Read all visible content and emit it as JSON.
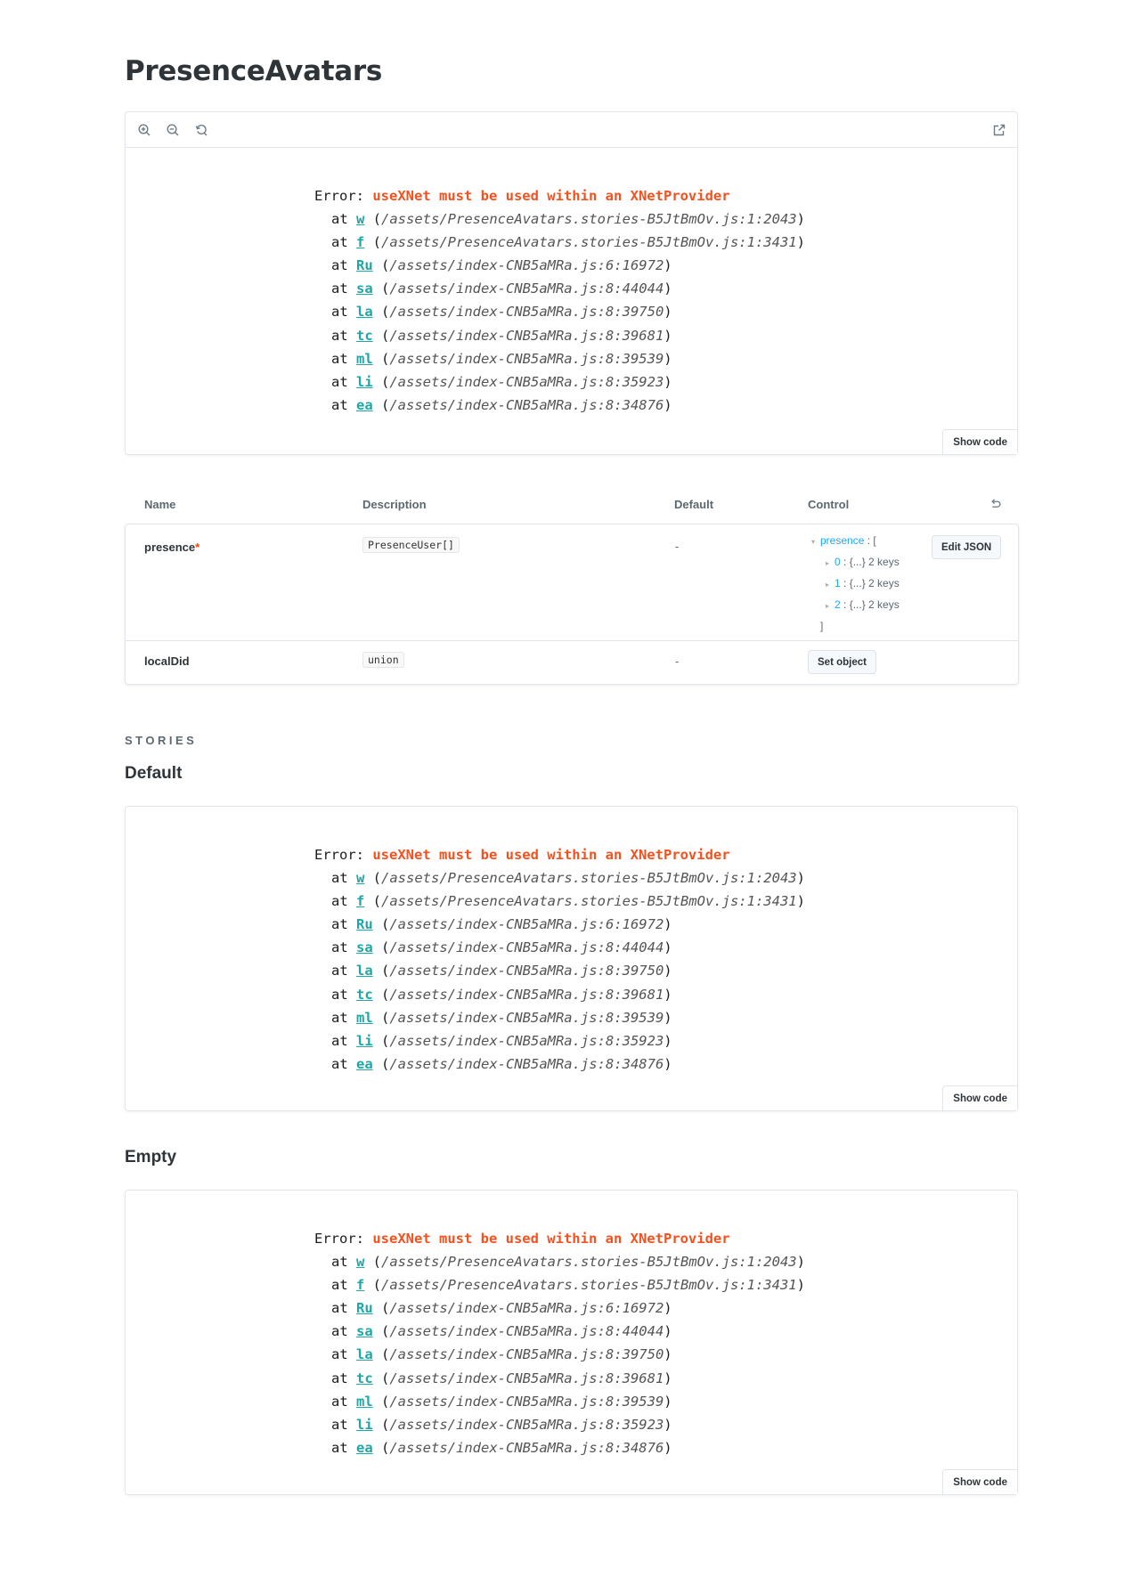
{
  "page": {
    "title": "PresenceAvatars"
  },
  "error": {
    "label": "Error: ",
    "message": "useXNet must be used within an XNetProvider",
    "frames": [
      {
        "at": "at ",
        "fn": "w",
        "loc": "/assets/PresenceAvatars.stories-B5JtBmOv.js:1:2043"
      },
      {
        "at": "at ",
        "fn": "f",
        "loc": "/assets/PresenceAvatars.stories-B5JtBmOv.js:1:3431"
      },
      {
        "at": "at ",
        "fn": "Ru",
        "loc": "/assets/index-CNB5aMRa.js:6:16972"
      },
      {
        "at": "at ",
        "fn": "sa",
        "loc": "/assets/index-CNB5aMRa.js:8:44044"
      },
      {
        "at": "at ",
        "fn": "la",
        "loc": "/assets/index-CNB5aMRa.js:8:39750"
      },
      {
        "at": "at ",
        "fn": "tc",
        "loc": "/assets/index-CNB5aMRa.js:8:39681"
      },
      {
        "at": "at ",
        "fn": "ml",
        "loc": "/assets/index-CNB5aMRa.js:8:39539"
      },
      {
        "at": "at ",
        "fn": "li",
        "loc": "/assets/index-CNB5aMRa.js:8:35923"
      },
      {
        "at": "at ",
        "fn": "ea",
        "loc": "/assets/index-CNB5aMRa.js:8:34876"
      }
    ]
  },
  "toolbar": {
    "icons": [
      "zoom-in-icon",
      "zoom-out-icon",
      "reset-zoom-icon",
      "open-new-tab-icon"
    ]
  },
  "show_code_label": "Show code",
  "args": {
    "headers": {
      "name": "Name",
      "description": "Description",
      "default": "Default",
      "control": "Control"
    },
    "rows": [
      {
        "name": "presence",
        "required": "*",
        "type": "PresenceUser[]",
        "default": "-",
        "tree": {
          "root_key": "presence",
          "root_open": " : [",
          "items": [
            {
              "key": "0",
              "value": " : {...} 2 keys"
            },
            {
              "key": "1",
              "value": " : {...} 2 keys"
            },
            {
              "key": "2",
              "value": " : {...} 2 keys"
            }
          ],
          "close": "]"
        },
        "button": "Edit JSON"
      },
      {
        "name": "localDid",
        "type": "union",
        "default": "-",
        "button": "Set object"
      }
    ]
  },
  "stories": {
    "label": "STORIES",
    "items": [
      {
        "title": "Default"
      },
      {
        "title": "Empty"
      }
    ]
  }
}
